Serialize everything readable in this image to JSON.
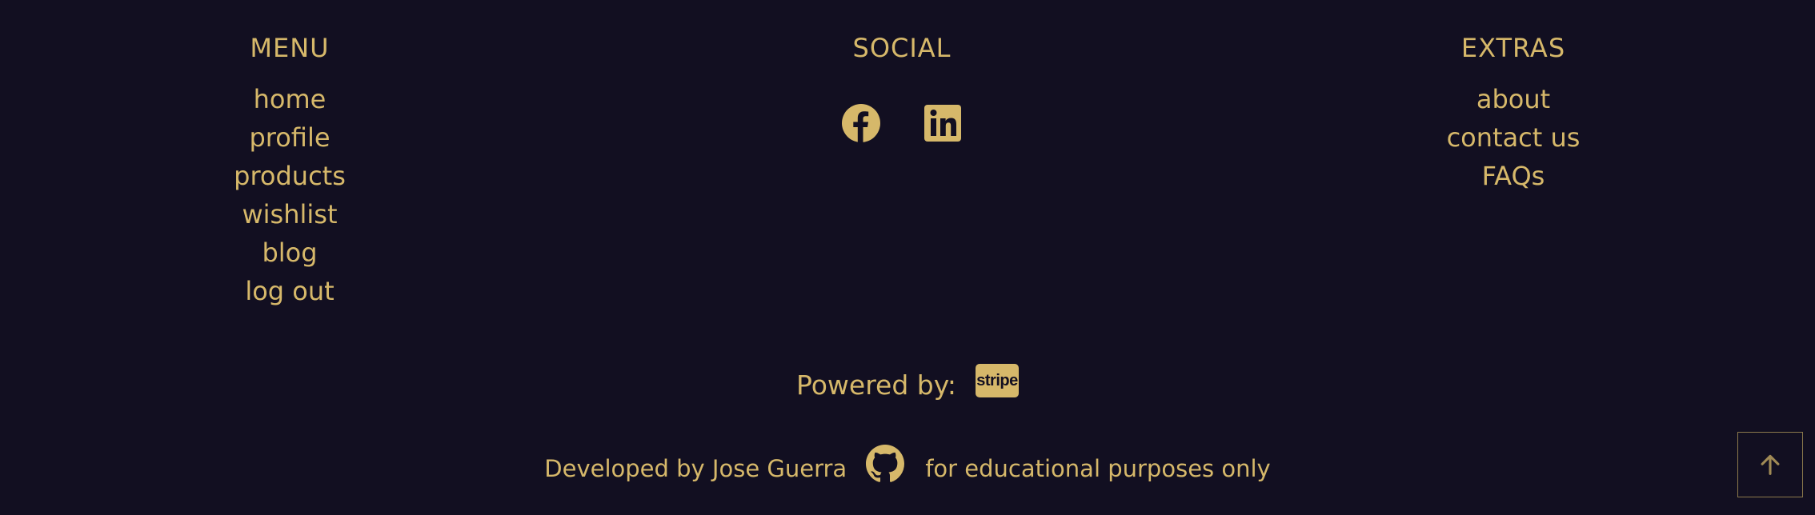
{
  "menu": {
    "title": "MENU",
    "items": [
      {
        "label": "home"
      },
      {
        "label": "profile"
      },
      {
        "label": "products"
      },
      {
        "label": "wishlist"
      },
      {
        "label": "blog"
      },
      {
        "label": "log out"
      }
    ]
  },
  "social": {
    "title": "SOCIAL",
    "links": [
      {
        "icon": "facebook-icon"
      },
      {
        "icon": "linkedin-icon"
      }
    ]
  },
  "extras": {
    "title": "EXTRAS",
    "items": [
      {
        "label": "about"
      },
      {
        "label": "contact us"
      },
      {
        "label": "FAQs"
      }
    ]
  },
  "powered": {
    "label": "Powered by:",
    "badge_text": "stripe"
  },
  "footer_credit": {
    "developer_text": "Developed by Jose Guerra",
    "icon": "github-icon",
    "note_text": "for educational purposes only"
  },
  "back_to_top": {
    "icon": "arrow-up-icon"
  },
  "colors": {
    "background": "#120f21",
    "accent": "#d6b86a"
  }
}
